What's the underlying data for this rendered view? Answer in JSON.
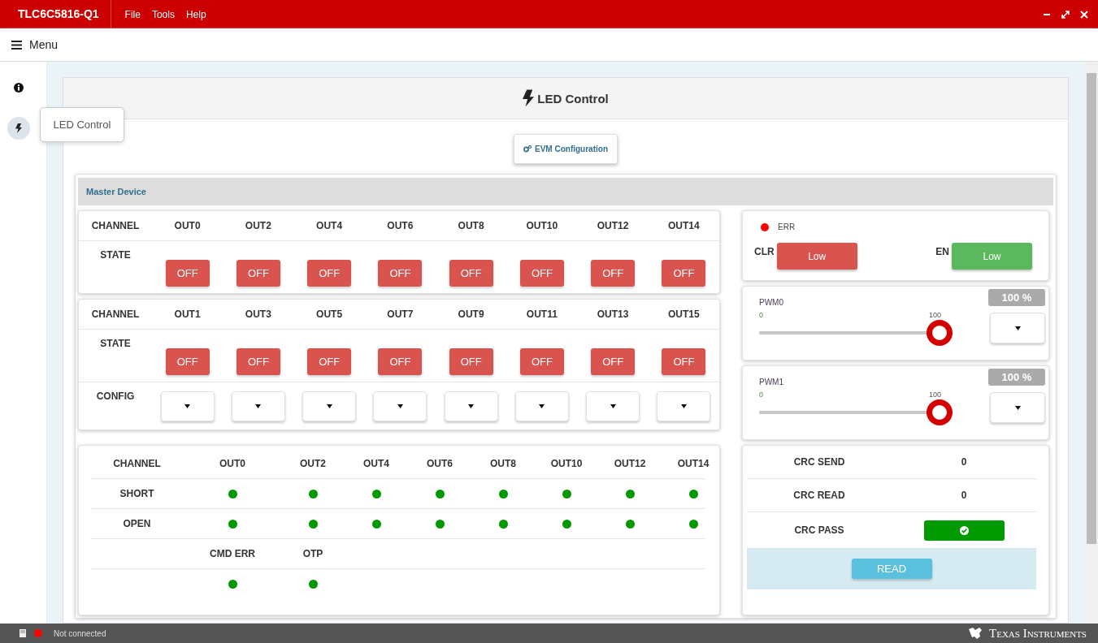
{
  "app_bar": {
    "title": "TLC6C5816-Q1",
    "menus": [
      "File",
      "Tools",
      "Help"
    ]
  },
  "menu_bar": {
    "label": "Menu"
  },
  "sidebar": {
    "items": [
      {
        "kind": "info",
        "selected": false
      },
      {
        "kind": "bolt",
        "selected": true
      }
    ],
    "tooltip": "LED Control"
  },
  "page": {
    "title": "LED Control",
    "config_button": "EVM Configuration"
  },
  "master": {
    "title": "Master Device",
    "state_tables": [
      {
        "header": "CHANNEL",
        "row_label": "STATE",
        "channels": [
          {
            "name": "OUT0",
            "state": "OFF"
          },
          {
            "name": "OUT2",
            "state": "OFF"
          },
          {
            "name": "OUT4",
            "state": "OFF"
          },
          {
            "name": "OUT6",
            "state": "OFF"
          },
          {
            "name": "OUT8",
            "state": "OFF"
          },
          {
            "name": "OUT10",
            "state": "OFF"
          },
          {
            "name": "OUT12",
            "state": "OFF"
          },
          {
            "name": "OUT14",
            "state": "OFF"
          }
        ]
      },
      {
        "header": "CHANNEL",
        "row_label": "STATE",
        "config_label": "CONFIG",
        "channels": [
          {
            "name": "OUT1",
            "state": "OFF"
          },
          {
            "name": "OUT3",
            "state": "OFF"
          },
          {
            "name": "OUT5",
            "state": "OFF"
          },
          {
            "name": "OUT7",
            "state": "OFF"
          },
          {
            "name": "OUT9",
            "state": "OFF"
          },
          {
            "name": "OUT11",
            "state": "OFF"
          },
          {
            "name": "OUT13",
            "state": "OFF"
          },
          {
            "name": "OUT15",
            "state": "OFF"
          }
        ]
      }
    ],
    "err": {
      "label": "ERR",
      "color": "#ff0000"
    },
    "controls": [
      {
        "label": "CLR",
        "value": "Low",
        "color": "#d9534f"
      },
      {
        "label": "EN",
        "value": "Low",
        "color": "#5cb85c"
      }
    ],
    "pwm": [
      {
        "name": "PWM0",
        "min": "0",
        "max": "100",
        "level": 1,
        "readout": "100 %"
      },
      {
        "name": "PWM1",
        "min": "0",
        "max": "100",
        "level": 1,
        "readout": "100 %"
      }
    ],
    "status": {
      "header": "CHANNEL",
      "columns": [
        "OUT0",
        "OUT2",
        "OUT4",
        "OUT6",
        "OUT8",
        "OUT10",
        "OUT12",
        "OUT14"
      ],
      "rows": [
        {
          "label": "SHORT",
          "dots": [
            {
              "color": "#009900"
            },
            {
              "color": "#009900"
            },
            {
              "color": "#009900"
            },
            {
              "color": "#009900"
            },
            {
              "color": "#009900"
            },
            {
              "color": "#009900"
            },
            {
              "color": "#009900"
            },
            {
              "color": "#009900"
            }
          ]
        },
        {
          "label": "OPEN",
          "dots": [
            {
              "color": "#009900"
            },
            {
              "color": "#009900"
            },
            {
              "color": "#009900"
            },
            {
              "color": "#009900"
            },
            {
              "color": "#009900"
            },
            {
              "color": "#009900"
            },
            {
              "color": "#009900"
            },
            {
              "color": "#009900"
            }
          ]
        }
      ],
      "extra": {
        "labels": [
          "CMD ERR",
          "OTP"
        ],
        "dots": [
          {
            "color": "#009900"
          },
          {
            "color": "#009900"
          }
        ]
      }
    },
    "crc": {
      "rows": [
        {
          "label": "CRC SEND",
          "value": "0"
        },
        {
          "label": "CRC READ",
          "value": "0"
        }
      ],
      "pass_label": "CRC PASS",
      "pass": true,
      "read_button": "READ"
    }
  },
  "status_bar": {
    "text": "Not connected",
    "connected": false,
    "brand": "Texas Instruments"
  }
}
